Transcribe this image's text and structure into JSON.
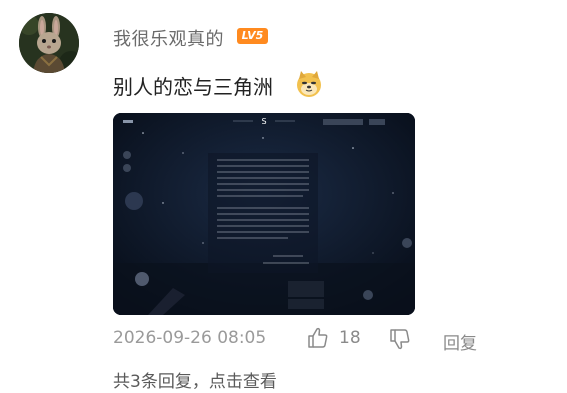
{
  "comment": {
    "username": "我很乐观真的",
    "level": "LV5",
    "text": "别人的恋与三角洲",
    "emoji_icon": "doge-emoji",
    "image_icon": "game-screenshot-thumbnail",
    "timestamp": "2026-09-26 08:05",
    "like_count": "18",
    "reply_label": "回复",
    "view_replies": "共3条回复，点击查看"
  },
  "screenshot_overlay": {
    "compass": "S"
  },
  "colors": {
    "level_badge": "#ff8a1f",
    "meta_text": "#9a9a9a",
    "body_text": "#222222"
  }
}
